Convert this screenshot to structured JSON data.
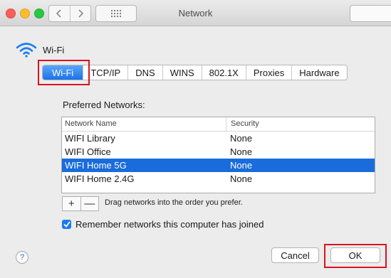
{
  "window": {
    "title": "Network"
  },
  "header": {
    "interface_label": "Wi-Fi"
  },
  "tabs": [
    {
      "label": "Wi-Fi",
      "active": true
    },
    {
      "label": "TCP/IP"
    },
    {
      "label": "DNS"
    },
    {
      "label": "WINS"
    },
    {
      "label": "802.1X"
    },
    {
      "label": "Proxies"
    },
    {
      "label": "Hardware"
    }
  ],
  "preferred": {
    "heading": "Preferred Networks:",
    "columns": {
      "name": "Network Name",
      "security": "Security"
    },
    "rows": [
      {
        "name": "WIFI Library",
        "security": "None"
      },
      {
        "name": "WIFI Office",
        "security": "None"
      },
      {
        "name": "WIFI Home 5G",
        "security": "None",
        "selected": true
      },
      {
        "name": "WIFI Home 2.4G",
        "security": "None"
      }
    ],
    "add_label": "+",
    "remove_label": "—",
    "drag_hint": "Drag networks into the order you prefer."
  },
  "remember": {
    "label": "Remember networks this computer has joined",
    "checked": true
  },
  "footer": {
    "help_label": "?",
    "cancel_label": "Cancel",
    "ok_label": "OK"
  },
  "colors": {
    "accent": "#1a6cdc",
    "highlight_box": "#d9141f"
  }
}
